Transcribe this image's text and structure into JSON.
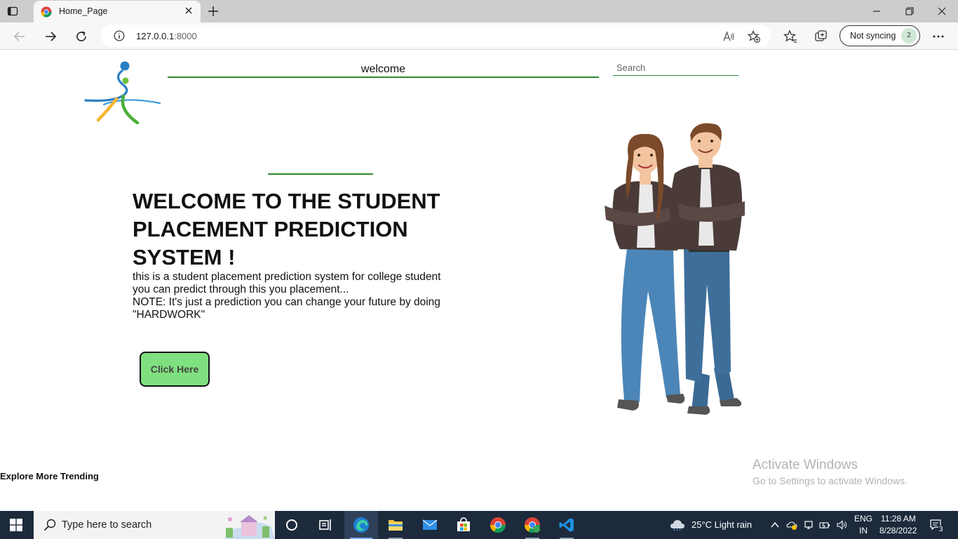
{
  "browser": {
    "tab_title": "Home_Page",
    "url_host": "127.0.0.1",
    "url_port": ":8000",
    "sync_label": "Not syncing",
    "sync_badge": "2"
  },
  "header": {
    "nav_label": "welcome",
    "search_placeholder": "Search"
  },
  "main": {
    "headline": "WELCOME TO THE STUDENT PLACEMENT PREDICTION SYSTEM !",
    "desc_line1": "this is a student placement prediction system for college student",
    "desc_line2": "you can predict through this you placement...",
    "desc_line3": "NOTE: It's just a prediction you can change your future by doing \"HARDWORK\"",
    "cta_label": "Click Here"
  },
  "footer": {
    "explore_label": "Explore More Trending"
  },
  "watermark": {
    "title": "Activate Windows",
    "subtitle": "Go to Settings to activate Windows."
  },
  "taskbar": {
    "search_text": "Type here to search",
    "weather": "25°C  Light rain",
    "lang_top": "ENG",
    "lang_bottom": "IN",
    "time": "11:28 AM",
    "date": "8/28/2022",
    "notif_count": "3"
  },
  "colors": {
    "accent_green": "#2e8b2e",
    "button_green": "#7ee07e",
    "taskbar_bg": "#1c2a3c"
  }
}
